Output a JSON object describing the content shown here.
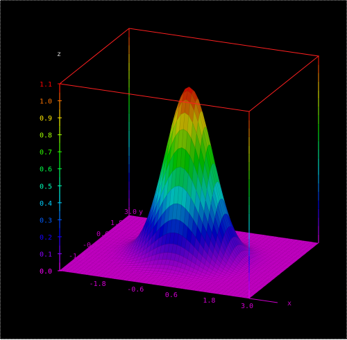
{
  "chart_data": {
    "type": "surface3d",
    "function": "exp(-(x^2 + y^2))",
    "x": {
      "label": "x",
      "range": [
        -3.0,
        3.0
      ],
      "ticks": [
        "-1.8",
        "-0.6",
        "0.6",
        "1.8",
        "3.0"
      ],
      "tick_values": [
        -1.8,
        -0.6,
        0.6,
        1.8,
        3.0
      ]
    },
    "y": {
      "label": "y",
      "range": [
        -3.0,
        3.0
      ],
      "ticks": [
        "-1.8",
        "-0.6",
        "0.6",
        "1.8",
        "3.0"
      ],
      "tick_values": [
        -1.8,
        -0.6,
        0.6,
        1.8,
        3.0
      ]
    },
    "z": {
      "label": "z",
      "range": [
        0.0,
        1.1
      ],
      "ticks": [
        "0.0",
        "0.1",
        "0.2",
        "0.3",
        "0.4",
        "0.5",
        "0.6",
        "0.7",
        "0.8",
        "0.9",
        "1.0",
        "1.1"
      ],
      "tick_values": [
        0.0,
        0.1,
        0.2,
        0.3,
        0.4,
        0.5,
        0.6,
        0.7,
        0.8,
        0.9,
        1.0,
        1.1
      ]
    },
    "peak": {
      "x": 0.0,
      "y": 0.0,
      "z": 1.0
    },
    "colormap": [
      "#ff00ff",
      "#0000ff",
      "#00ffff",
      "#00ff00",
      "#ffff00",
      "#ff0000"
    ],
    "box_color": "#ff2020",
    "background": "#000000"
  }
}
